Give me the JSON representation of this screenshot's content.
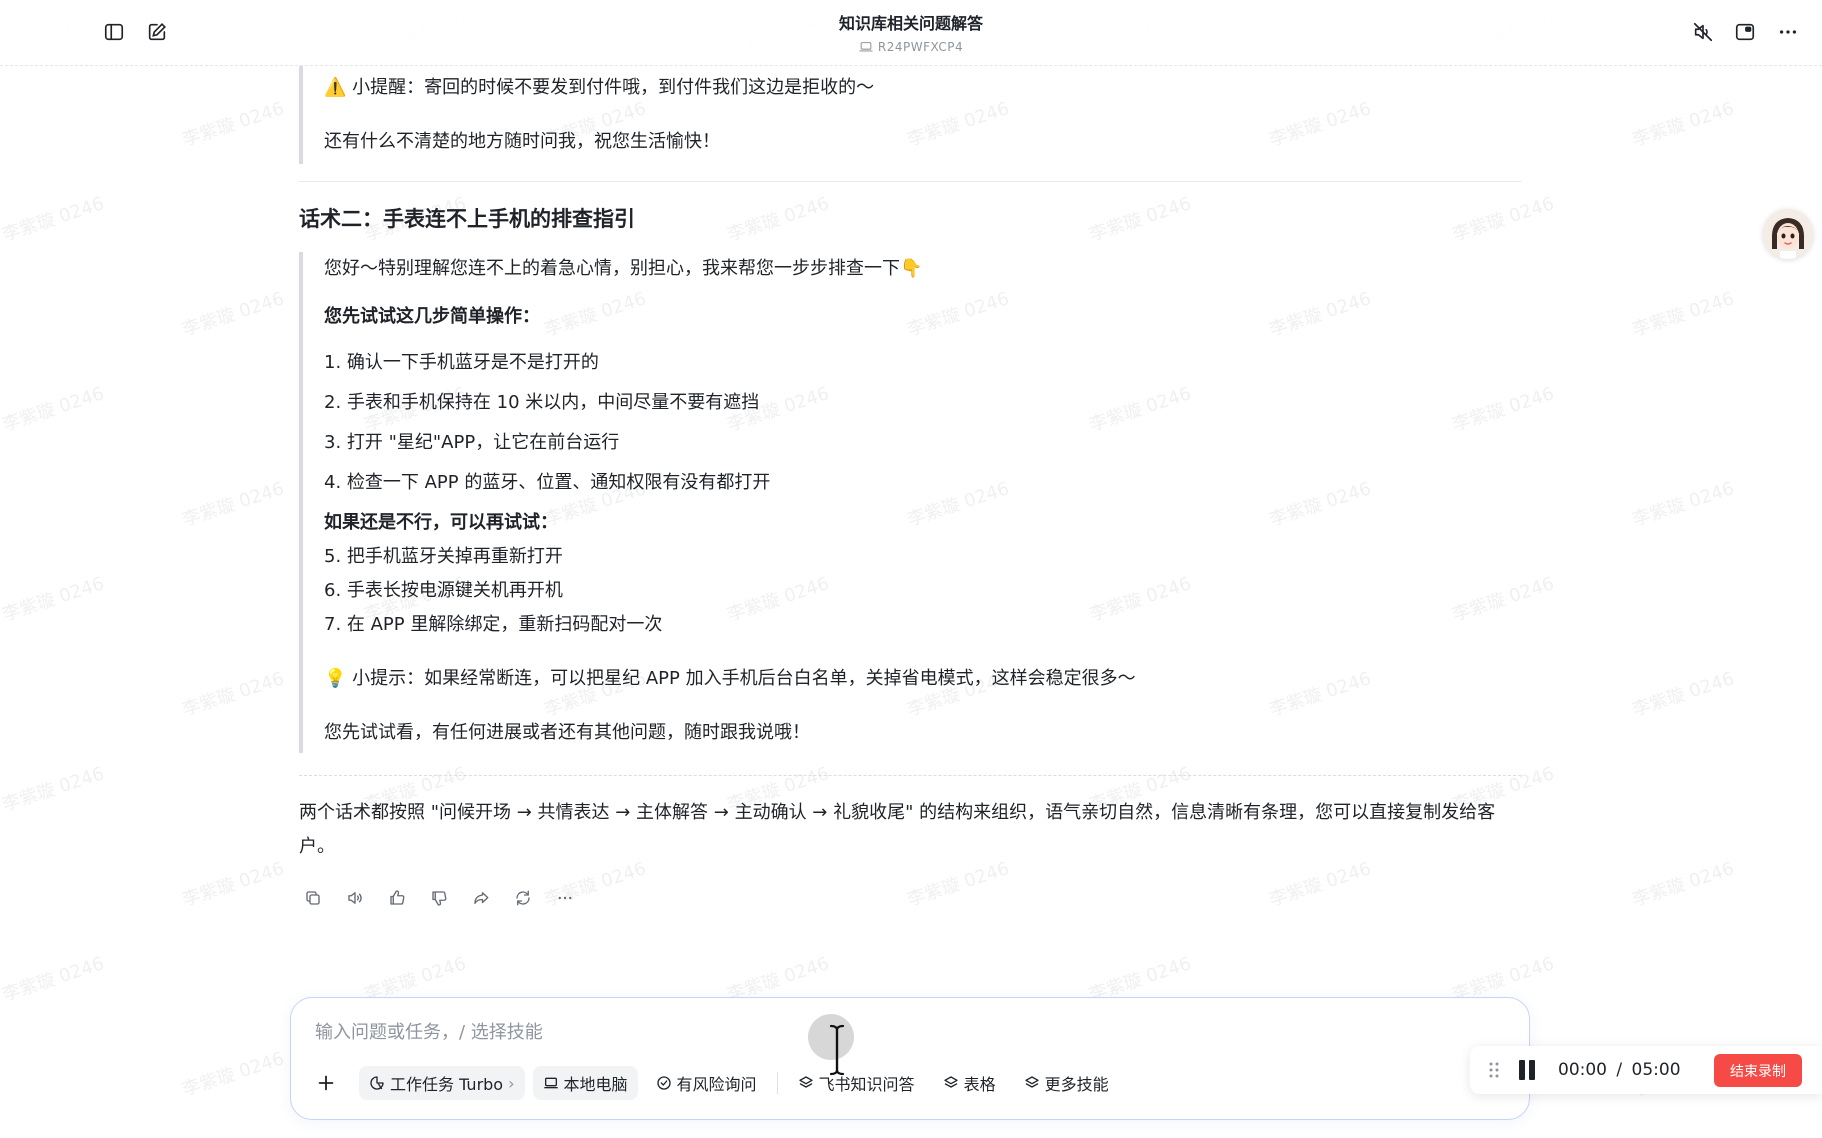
{
  "header": {
    "title": "知识库相关问题解答",
    "device_id": "R24PWFXCP4"
  },
  "watermark_text": "李紫璇 0246",
  "content": {
    "reminder": "⚠️ 小提醒：寄回的时候不要发到付件哦，到付件我们这边是拒收的～",
    "closing_1": "还有什么不清楚的地方随时问我，祝您生活愉快！",
    "section2_title": "话术二：手表连不上手机的排查指引",
    "greeting": "您好～特别理解您连不上的着急心情，别担心，我来帮您一步步排查一下👇",
    "steps_title": "您先试试这几步简单操作：",
    "steps": [
      "1. 确认一下手机蓝牙是不是打开的",
      "2. 手表和手机保持在 10 米以内，中间尽量不要有遮挡",
      "3. 打开 \"星纪\"APP，让它在前台运行",
      "4. 检查一下 APP 的蓝牙、位置、通知权限有没有都打开"
    ],
    "more_title": "如果还是不行，可以再试试：",
    "more_steps": [
      "5. 把手机蓝牙关掉再重新打开",
      "6. 手表长按电源键关机再开机",
      "7. 在 APP 里解除绑定，重新扫码配对一次"
    ],
    "tip": "💡 小提示：如果经常断连，可以把星纪 APP 加入手机后台白名单，关掉省电模式，这样会稳定很多～",
    "closing_2": "您先试试看，有任何进展或者还有其他问题，随时跟我说哦！",
    "summary": "两个话术都按照 \"问候开场 → 共情表达 → 主体解答 → 主动确认 → 礼貌收尾\" 的结构来组织，语气亲切自然，信息清晰有条理，您可以直接复制发给客户。"
  },
  "composer": {
    "placeholder": "输入问题或任务，/ 选择技能",
    "chips": {
      "turbo": "工作任务 Turbo",
      "local": "本地电脑",
      "risk": "有风险询问",
      "feishu": "飞书知识问答",
      "table": "表格",
      "more": "更多技能"
    }
  },
  "recording": {
    "elapsed": "00:00",
    "separator": "/",
    "total": "05:00",
    "end_label": "结束录制"
  }
}
